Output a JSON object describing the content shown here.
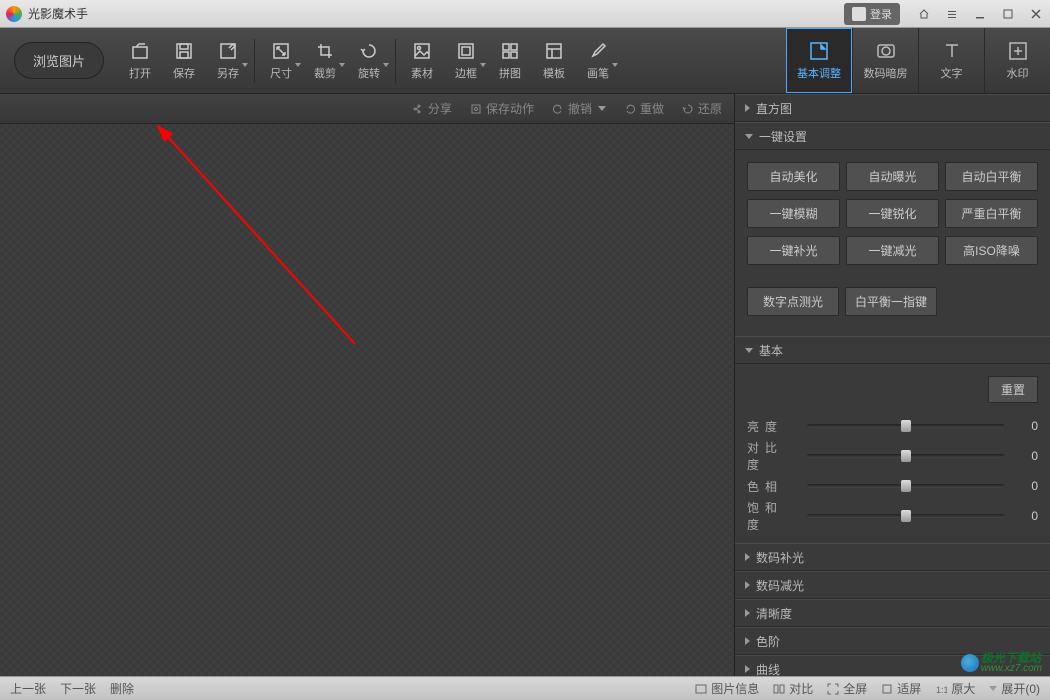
{
  "title": "光影魔术手",
  "login": "登录",
  "toolbar": {
    "browse": "浏览图片",
    "items": [
      {
        "label": "打开",
        "icon": "open"
      },
      {
        "label": "保存",
        "icon": "save"
      },
      {
        "label": "另存",
        "icon": "saveas",
        "dd": true
      },
      {
        "sep": true
      },
      {
        "label": "尺寸",
        "icon": "size",
        "dd": true
      },
      {
        "label": "裁剪",
        "icon": "crop",
        "dd": true
      },
      {
        "label": "旋转",
        "icon": "rotate",
        "dd": true
      },
      {
        "sep": true
      },
      {
        "label": "素材",
        "icon": "material"
      },
      {
        "label": "边框",
        "icon": "frame",
        "dd": true
      },
      {
        "label": "拼图",
        "icon": "collage"
      },
      {
        "label": "模板",
        "icon": "template"
      },
      {
        "label": "画笔",
        "icon": "brush",
        "dd": true
      }
    ]
  },
  "tabs": [
    {
      "label": "基本调整",
      "icon": "adjust",
      "active": true
    },
    {
      "label": "数码暗房",
      "icon": "darkroom"
    },
    {
      "label": "文字",
      "icon": "text"
    },
    {
      "label": "水印",
      "icon": "watermark"
    }
  ],
  "subtoolbar": {
    "share": "分享",
    "saveaction": "保存动作",
    "undo": "撤销",
    "redo": "重做",
    "restore": "还原"
  },
  "panel": {
    "histogram": "直方图",
    "oneclick": {
      "title": "一键设置",
      "row1": [
        "自动美化",
        "自动曝光",
        "自动白平衡"
      ],
      "row2": [
        "一键模糊",
        "一键锐化",
        "严重白平衡"
      ],
      "row3": [
        "一键补光",
        "一键减光",
        "高ISO降噪"
      ],
      "row4": [
        "数字点测光",
        "白平衡一指键"
      ]
    },
    "basic": {
      "title": "基本",
      "reset": "重置",
      "sliders": [
        {
          "label": "亮度",
          "value": 0,
          "pos": 50
        },
        {
          "label": "对比度",
          "value": 0,
          "pos": 50
        },
        {
          "label": "色相",
          "value": 0,
          "pos": 50
        },
        {
          "label": "饱和度",
          "value": 0,
          "pos": 50
        }
      ]
    },
    "collapsed": [
      "数码补光",
      "数码减光",
      "清晰度",
      "色阶",
      "曲线"
    ]
  },
  "statusbar": {
    "prev": "上一张",
    "next": "下一张",
    "delete": "删除",
    "info": "图片信息",
    "compare": "对比",
    "fullscreen": "全屏",
    "fit": "适屏",
    "orig": "原大",
    "expand": "展开(0)"
  },
  "watermark": {
    "text": "极光下载站",
    "url": "www.xz7.com"
  }
}
